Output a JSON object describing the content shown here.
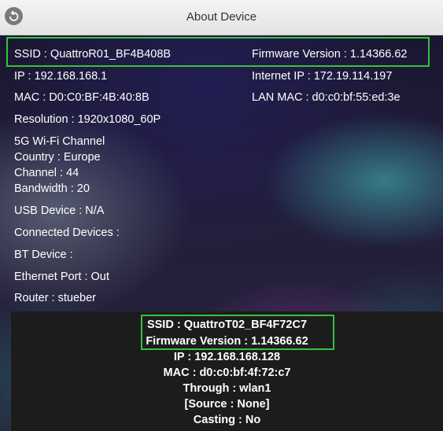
{
  "header": {
    "title": "About Device",
    "back_icon": "back-arrow-icon"
  },
  "device": {
    "ssid": "SSID : QuattroR01_BF4B408B",
    "firmware": "Firmware Version : 1.14366.62",
    "ip": "IP : 192.168.168.1",
    "internet_ip": "Internet IP : 172.19.114.197",
    "mac": "MAC : D0:C0:BF:4B:40:8B",
    "lan_mac": "LAN MAC : d0:c0:bf:55:ed:3e",
    "resolution": "Resolution : 1920x1080_60P",
    "wifi_heading": "5G Wi-Fi Channel",
    "country": "Country : Europe",
    "channel": "Channel : 44",
    "bandwidth": "Bandwidth : 20",
    "usb": "USB Device : N/A",
    "connected": "Connected Devices :",
    "bt": "BT Device :",
    "ethernet": "Ethernet Port : Out",
    "router": "Router : stueber"
  },
  "client": {
    "ssid": "SSID : QuattroT02_BF4F72C7",
    "firmware": "Firmware Version : 1.14366.62",
    "ip": "IP : 192.168.168.128",
    "mac": "MAC : d0:c0:bf:4f:72:c7",
    "through": "Through : wlan1",
    "source": "[Source : None]",
    "casting": "Casting : No"
  },
  "colors": {
    "highlight": "#35c23b",
    "header_bg": "#eaeaea",
    "panel_bg": "#1c1c1c"
  }
}
